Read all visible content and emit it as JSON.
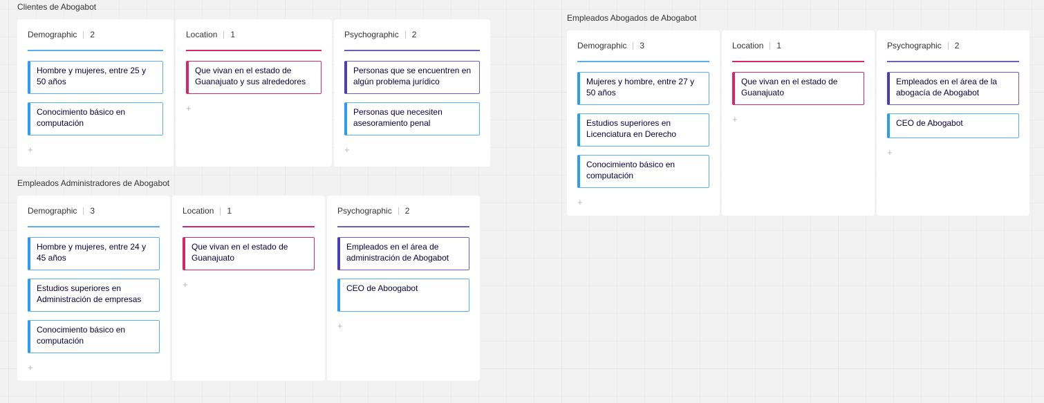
{
  "boards": [
    {
      "title": "Clientes de Abogabot",
      "columns": [
        {
          "name": "Demographic",
          "count": "2",
          "color": "#5aaef0",
          "cards": [
            "Hombre y mujeres, entre 25 y 50 años",
            "Conocimiento básico en computación"
          ]
        },
        {
          "name": "Location",
          "count": "1",
          "color": "#d6256a",
          "cards": [
            "Que vivan en el estado de Guanajuato y sus alrededores"
          ]
        },
        {
          "name": "Psychographic",
          "count": "2",
          "color": "#6a5fbf",
          "cards": [
            "Personas que se encuentren en algún problema jurídico",
            "Personas que necesiten asesoramiento penal"
          ]
        }
      ]
    },
    {
      "title": "Empleados Administradores de Abogabot",
      "columns": [
        {
          "name": "Demographic",
          "count": "3",
          "color": "#5aaef0",
          "cards": [
            "Hombre y mujeres, entre 24 y 45 años",
            "Estudios superiores en Administración de empresas",
            "Conocimiento básico en computación"
          ]
        },
        {
          "name": "Location",
          "count": "1",
          "color": "#d6256a",
          "cards": [
            "Que vivan en el estado de Guanajuato"
          ]
        },
        {
          "name": "Psychographic",
          "count": "2",
          "color": "#6a5fbf",
          "cards": [
            "Empleados en el área de administración de Abogabot",
            "CEO de Aboogabot"
          ]
        }
      ]
    },
    {
      "title": "Empleados Abogados de Abogabot",
      "columns": [
        {
          "name": "Demographic",
          "count": "3",
          "color": "#5aaef0",
          "cards": [
            "Mujeres y hombre, entre 27 y 50 años",
            "Estudios superiores en Licenciatura en Derecho",
            "Conocimiento básico en computación"
          ]
        },
        {
          "name": "Location",
          "count": "1",
          "color": "#d6256a",
          "cards": [
            "Que vivan en el estado de Guanajuato"
          ]
        },
        {
          "name": "Psychographic",
          "count": "2",
          "color": "#6a5fbf",
          "cards": [
            "Empleados en el área de la abogacía de Abogabot",
            "CEO de Abogabot"
          ]
        }
      ]
    }
  ],
  "add_symbol": "+"
}
